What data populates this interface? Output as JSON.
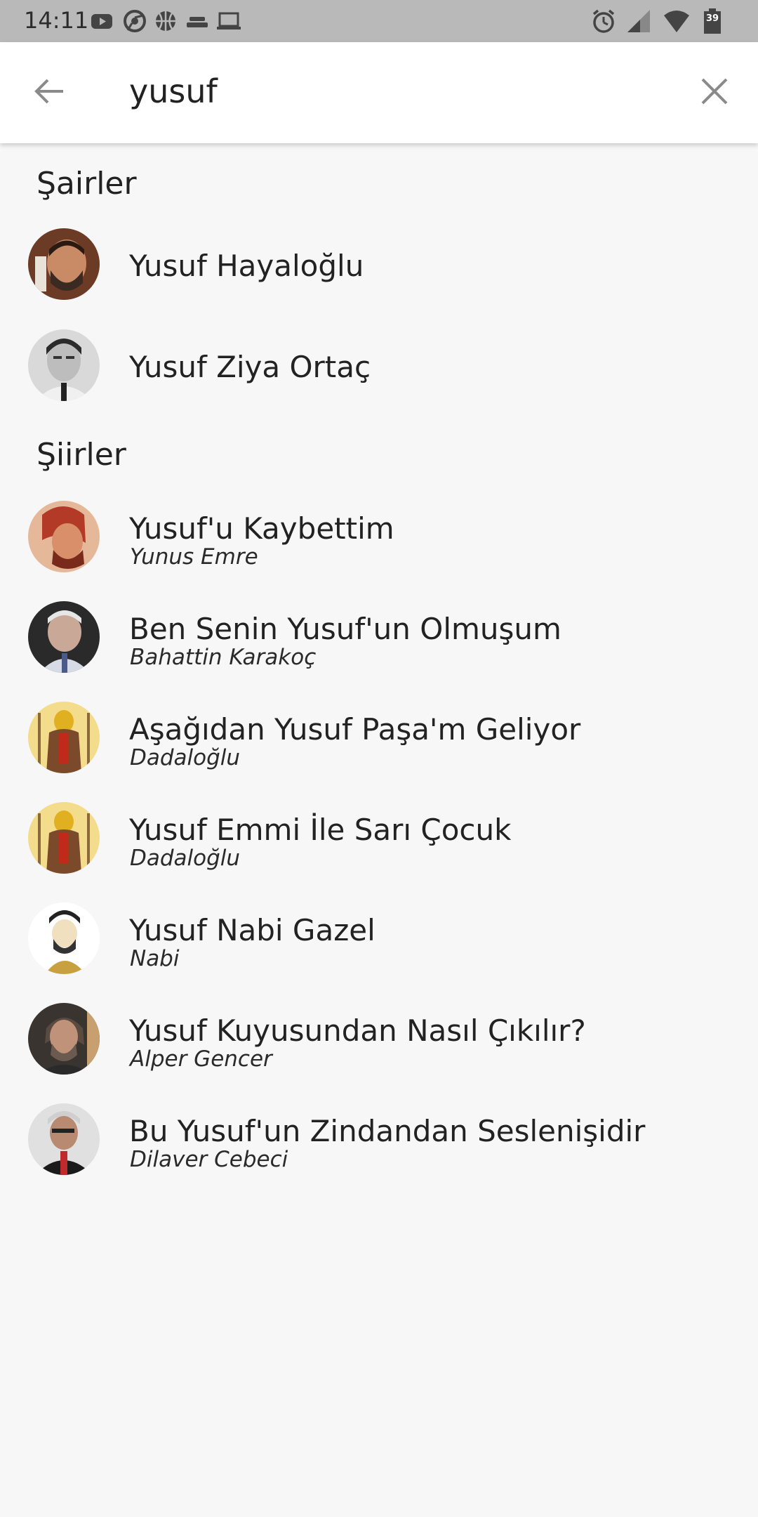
{
  "status_bar": {
    "time": "14:11",
    "battery_level": "39",
    "left_icons": [
      "youtube-icon",
      "chrome-icon",
      "basketball-icon",
      "cast-icon",
      "laptop-icon"
    ],
    "right_icons": [
      "alarm-icon",
      "signal-icon",
      "wifi-icon",
      "battery-icon"
    ]
  },
  "search": {
    "value": "yusuf",
    "placeholder": ""
  },
  "sections": {
    "poets_title": "Şairler",
    "poems_title": "Şiirler"
  },
  "poets": [
    {
      "name": "Yusuf Hayaloğlu",
      "avatar": "poet-photo"
    },
    {
      "name": "Yusuf Ziya Ortaç",
      "avatar": "poet-photo-bw"
    }
  ],
  "poems": [
    {
      "title": "Yusuf'u Kaybettim",
      "author": "Yunus Emre"
    },
    {
      "title": "Ben Senin Yusuf'un Olmuşum",
      "author": "Bahattin Karakoç"
    },
    {
      "title": "Aşağıdan Yusuf Paşa'm Geliyor",
      "author": "Dadaloğlu"
    },
    {
      "title": "Yusuf Emmi İle Sarı Çocuk",
      "author": "Dadaloğlu"
    },
    {
      "title": "Yusuf Nabi Gazel",
      "author": "Nabi"
    },
    {
      "title": "Yusuf Kuyusundan Nasıl Çıkılır?",
      "author": "Alper Gencer"
    },
    {
      "title": "Bu Yusuf'un Zindandan Seslenişidir",
      "author": "Dilaver Cebeci"
    }
  ],
  "colors": {
    "status_bar": "#b9b9b9",
    "app_bar": "#ffffff",
    "background": "#f7f7f7",
    "icon_gray": "#8a8a8a"
  }
}
